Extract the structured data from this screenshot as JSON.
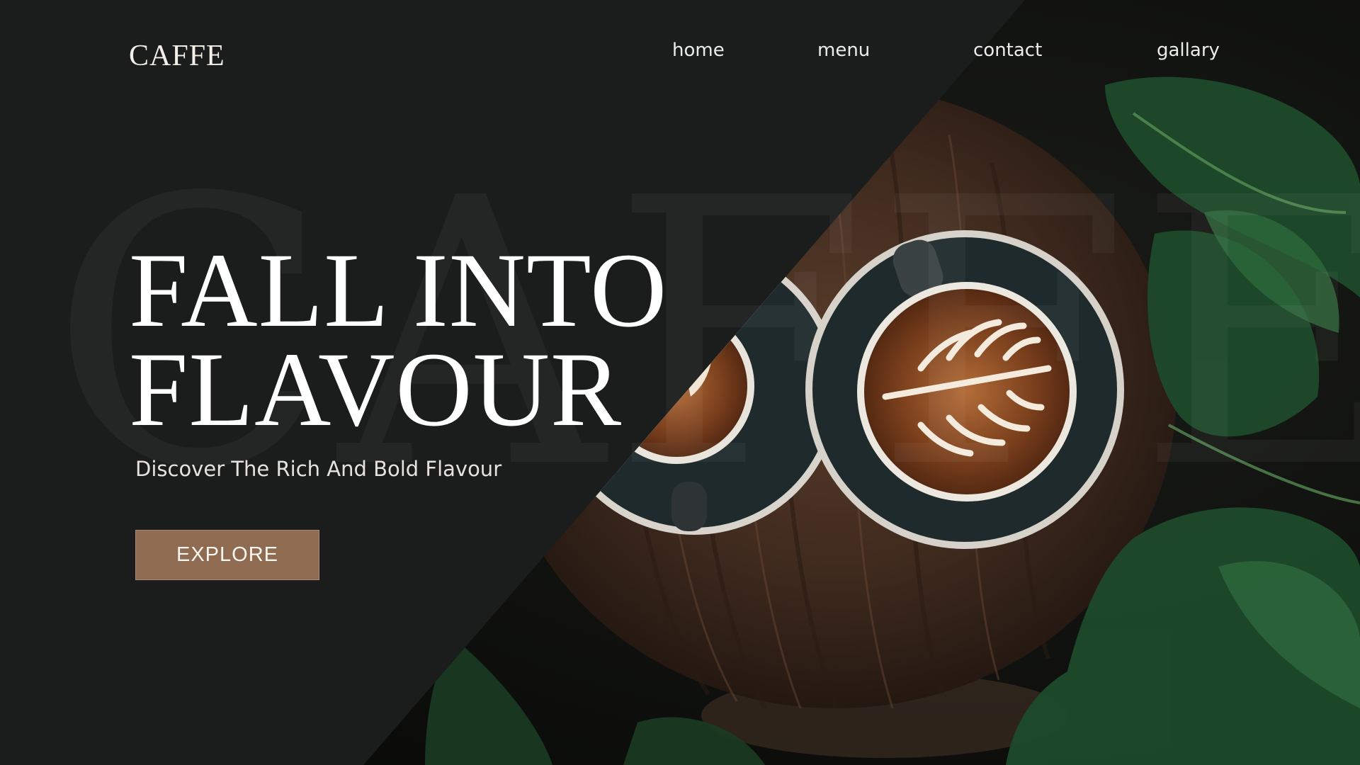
{
  "header": {
    "logo": "CAFFE",
    "nav": [
      {
        "label": "home"
      },
      {
        "label": "menu"
      },
      {
        "label": "contact"
      },
      {
        "label": "gallary"
      }
    ]
  },
  "hero": {
    "watermark": "CAFFE",
    "title_line1": "FALL INTO",
    "title_line2": "FLAVOUR",
    "subtitle": "Discover The Rich And Bold Flavour",
    "cta_label": "EXPLORE"
  },
  "colors": {
    "background": "#1b1c1c",
    "button": "#8f6b52",
    "text": "#ffffff"
  },
  "image": {
    "subject": "two-latte-cups-on-wooden-table-with-plants-icon"
  }
}
